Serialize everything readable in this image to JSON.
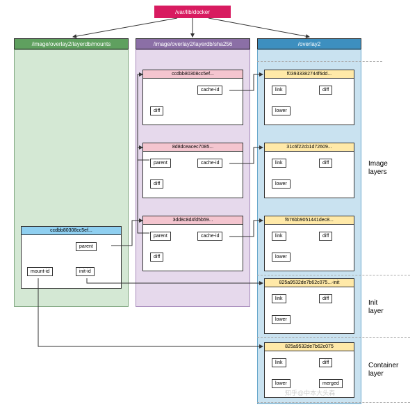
{
  "root": {
    "label": "/var/lib/docker"
  },
  "columns": {
    "mounts": {
      "header": "/image/overlay2/layerdb/mounts"
    },
    "sha256": {
      "header": "/image/overlay2/layerdb/sha256"
    },
    "overlay2": {
      "header": "/overlay2"
    }
  },
  "mounts_card": {
    "title": "ccdbb80308cc5ef...",
    "parent": "parent",
    "mount_id": "mount-id",
    "init_id": "init-id"
  },
  "sha_cards": [
    {
      "title": "ccdbb80308cc5ef...",
      "cache_id": "cache-id",
      "diff": "diff"
    },
    {
      "title": "8d8dceacec7085...",
      "parent": "parent",
      "cache_id": "cache-id",
      "diff": "diff"
    },
    {
      "title": "3dd8c8d4fd5b59...",
      "parent": "parent",
      "cache_id": "cache-id",
      "diff": "diff"
    }
  ],
  "overlay_cards": [
    {
      "title": "f03933382744f6dd...",
      "link": "link",
      "diff": "diff",
      "lower": "lower"
    },
    {
      "title": "31c6f22cb1d72609...",
      "link": "link",
      "diff": "diff",
      "lower": "lower"
    },
    {
      "title": "f676bb9051441dec8...",
      "link": "link",
      "diff": "diff",
      "lower": "lower"
    },
    {
      "title": "825a9532de7b62c075...-init",
      "link": "link",
      "diff": "diff",
      "lower": "lower"
    },
    {
      "title": "825a9532de7b62c075",
      "link": "link",
      "diff": "diff",
      "lower": "lower",
      "merged": "merged"
    }
  ],
  "section_labels": {
    "image": "Image\nlayers",
    "init": "Init\nlayer",
    "container": "Container\nlayer"
  },
  "watermark": "知乎@中本大头森"
}
